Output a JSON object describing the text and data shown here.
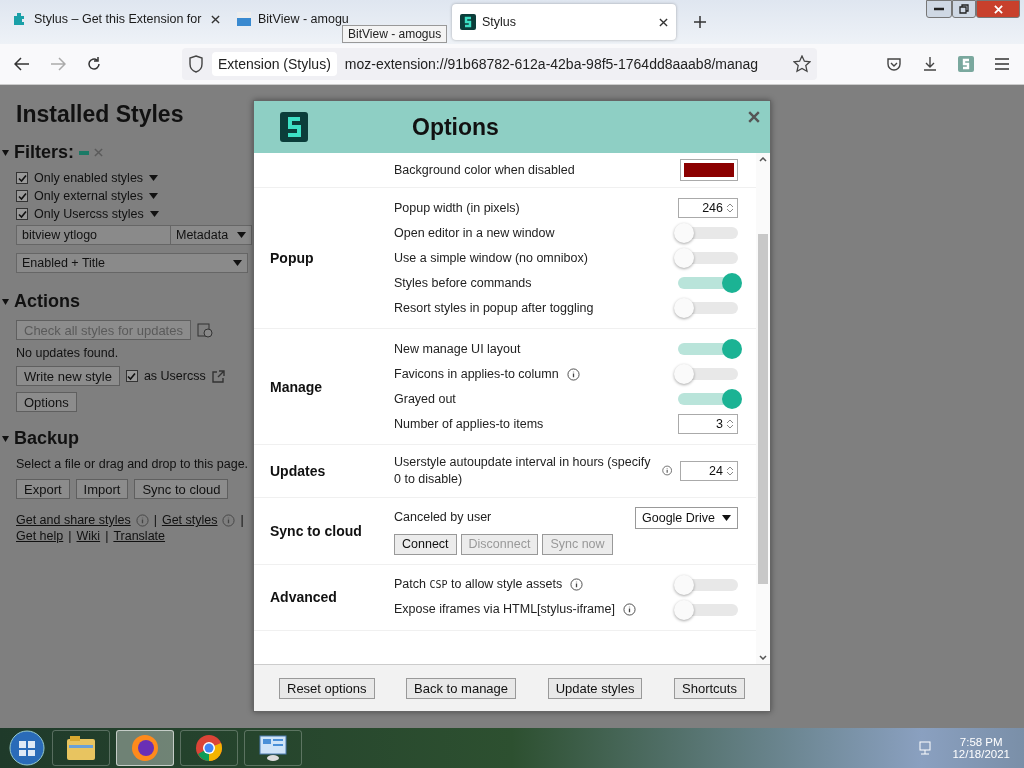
{
  "browser": {
    "tabs": [
      {
        "title": "Stylus – Get this Extension for",
        "selected": false
      },
      {
        "title": "BitView - amogu",
        "selected": false
      },
      {
        "title": "Stylus",
        "selected": true
      }
    ],
    "tooltip": "BitView - amogus",
    "identity": "Extension (Stylus)",
    "url": "moz-extension://91b68782-612a-42ba-98f5-1764dd8aaab8/manag"
  },
  "manager": {
    "title": "Installed Styles",
    "filters": {
      "heading": "Filters:",
      "checkboxes": [
        {
          "label": "Only enabled styles",
          "checked": true
        },
        {
          "label": "Only external styles",
          "checked": true
        },
        {
          "label": "Only Usercss styles",
          "checked": true
        }
      ],
      "search": "bitview ytlogo",
      "search_type": "Metadata",
      "sort": "Enabled + Title"
    },
    "actions": {
      "heading": "Actions",
      "check_button": {
        "label": "Check all styles for updates",
        "disabled": true
      },
      "status": "No updates found.",
      "write_button": "Write new style",
      "usercss": {
        "label": "as Usercss",
        "checked": true
      },
      "options_button": "Options"
    },
    "backup": {
      "heading": "Backup",
      "hint": "Select a file or drag and drop to this page.",
      "buttons": [
        "Export",
        "Import",
        "Sync to cloud"
      ]
    },
    "links": [
      {
        "label": "Get and share styles",
        "info": true,
        "separator": "|"
      },
      {
        "label": "Get styles",
        "info": true,
        "separator": "|"
      },
      {
        "label": "Get help",
        "info": false,
        "separator": "|"
      },
      {
        "label": "Wiki",
        "info": false,
        "separator": "|"
      },
      {
        "label": "Translate",
        "info": false
      }
    ]
  },
  "options": {
    "title": "Options",
    "sections": [
      {
        "rows": [
          {
            "kind": "color",
            "label": "Background color when disabled",
            "color": "#8b0000"
          }
        ]
      },
      {
        "title": "Popup",
        "rows": [
          {
            "kind": "number",
            "label": "Popup width (in pixels)",
            "value": "246"
          },
          {
            "kind": "toggle",
            "label": "Open editor in a new window",
            "on": false
          },
          {
            "kind": "toggle",
            "label": "Use a simple window (no omnibox)",
            "on": false
          },
          {
            "kind": "toggle",
            "label": "Styles before commands",
            "on": true
          },
          {
            "kind": "toggle",
            "label": "Resort styles in popup after toggling",
            "on": false
          }
        ]
      },
      {
        "title": "Manage",
        "rows": [
          {
            "kind": "toggle",
            "label": "New manage UI layout",
            "on": true
          },
          {
            "kind": "toggle",
            "label": "Favicons in applies-to column",
            "info": true,
            "on": false
          },
          {
            "kind": "toggle",
            "label": "Grayed out",
            "on": true
          },
          {
            "kind": "number",
            "label": "Number of applies-to items",
            "value": "3"
          }
        ]
      },
      {
        "title": "Updates",
        "rows": [
          {
            "kind": "number",
            "label": "Userstyle autoupdate interval in hours (specify 0 to disable)",
            "info": true,
            "value": "24"
          }
        ]
      },
      {
        "title": "Sync to cloud",
        "rows": [
          {
            "kind": "select",
            "label": "Canceled by user",
            "value": "Google Drive"
          },
          {
            "kind": "buttons",
            "buttons": [
              {
                "label": "Connect",
                "disabled": false
              },
              {
                "label": "Disconnect",
                "disabled": true
              },
              {
                "label": "Sync now",
                "disabled": true
              }
            ]
          }
        ]
      },
      {
        "title": "Advanced",
        "rows": [
          {
            "kind": "toggle",
            "label": "Patch",
            "code": "CSP",
            "label_after": "to allow style assets",
            "info": true,
            "on": false
          },
          {
            "kind": "toggle",
            "label": "Expose iframes via HTML[stylus-iframe]",
            "info": true,
            "on": false
          }
        ]
      }
    ],
    "footer": [
      "Reset options",
      "Back to manage",
      "Update styles",
      "Shortcuts"
    ]
  },
  "taskbar": {
    "apps": [
      {
        "selected": false
      },
      {
        "selected": true
      },
      {
        "selected": false
      },
      {
        "selected": false
      }
    ],
    "time": "7:58 PM",
    "date": "12/18/2021"
  }
}
